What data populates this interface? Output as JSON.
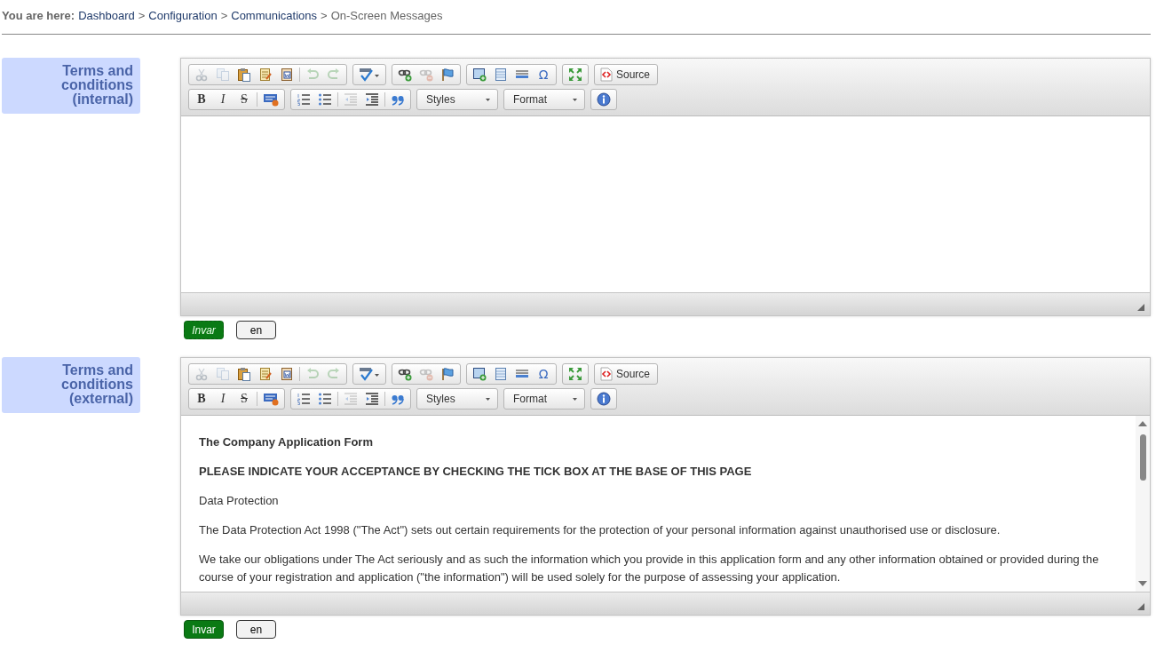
{
  "breadcrumb": {
    "prefix": "You are here:",
    "links": [
      "Dashboard",
      "Configuration",
      "Communications"
    ],
    "separator": ">",
    "current": "On-Screen Messages"
  },
  "fields": [
    {
      "label": "Terms and conditions (internal)",
      "editor": {
        "toolbar_rows": [
          [
            {
              "items": [
                {
                  "kind": "cut",
                  "disabled": true
                },
                {
                  "kind": "copy",
                  "disabled": true
                },
                {
                  "kind": "paste",
                  "disabled": false
                },
                {
                  "kind": "paste-text",
                  "disabled": false
                },
                {
                  "kind": "paste-word",
                  "disabled": false
                },
                {
                  "kind": "separator"
                },
                {
                  "kind": "undo",
                  "disabled": true
                },
                {
                  "kind": "redo",
                  "disabled": true
                }
              ]
            },
            {
              "items": [
                {
                  "kind": "spellcheck",
                  "disabled": false
                }
              ]
            },
            {
              "items": [
                {
                  "kind": "link",
                  "disabled": false
                },
                {
                  "kind": "unlink",
                  "disabled": true
                },
                {
                  "kind": "anchor",
                  "disabled": false
                }
              ]
            },
            {
              "items": [
                {
                  "kind": "image",
                  "disabled": false
                },
                {
                  "kind": "table",
                  "disabled": false
                },
                {
                  "kind": "rule",
                  "disabled": false
                },
                {
                  "kind": "glyph",
                  "glyph": "Ω",
                  "disabled": false
                }
              ]
            },
            {
              "items": [
                {
                  "kind": "maximize",
                  "disabled": false
                }
              ]
            },
            {
              "items": [
                {
                  "kind": "source",
                  "label": "Source",
                  "disabled": false
                }
              ]
            }
          ],
          [
            {
              "items": [
                {
                  "kind": "bold",
                  "glyph": "B",
                  "disabled": false
                },
                {
                  "kind": "italic",
                  "glyph": "I",
                  "disabled": false
                },
                {
                  "kind": "strike",
                  "glyph": "S",
                  "disabled": false
                },
                {
                  "kind": "separator"
                },
                {
                  "kind": "html",
                  "disabled": false
                }
              ]
            },
            {
              "items": [
                {
                  "kind": "numbered-list",
                  "disabled": false
                },
                {
                  "kind": "bulleted-list",
                  "disabled": false
                },
                {
                  "kind": "separator"
                },
                {
                  "kind": "outdent",
                  "disabled": true
                },
                {
                  "kind": "indent",
                  "disabled": false
                },
                {
                  "kind": "separator"
                },
                {
                  "kind": "blockquote",
                  "disabled": false
                }
              ]
            },
            {
              "items": [
                {
                  "kind": "combo",
                  "label": "Styles"
                }
              ]
            },
            {
              "items": [
                {
                  "kind": "combo",
                  "label": "Format"
                }
              ]
            },
            {
              "items": [
                {
                  "kind": "about",
                  "disabled": false
                }
              ]
            }
          ]
        ],
        "scrollable": false
      },
      "buttons": [
        {
          "label": "Invar",
          "kind": "primary",
          "focused": true
        },
        {
          "label": "en",
          "kind": "secondary",
          "focused": false
        }
      ]
    },
    {
      "label": "Terms and conditions (external)",
      "editor": {
        "toolbar_rows": [
          [
            {
              "items": [
                {
                  "kind": "cut",
                  "disabled": true
                },
                {
                  "kind": "copy",
                  "disabled": true
                },
                {
                  "kind": "paste",
                  "disabled": false
                },
                {
                  "kind": "paste-text",
                  "disabled": false
                },
                {
                  "kind": "paste-word",
                  "disabled": false
                },
                {
                  "kind": "separator"
                },
                {
                  "kind": "undo",
                  "disabled": true
                },
                {
                  "kind": "redo",
                  "disabled": true
                }
              ]
            },
            {
              "items": [
                {
                  "kind": "spellcheck",
                  "disabled": false
                }
              ]
            },
            {
              "items": [
                {
                  "kind": "link",
                  "disabled": false
                },
                {
                  "kind": "unlink",
                  "disabled": true
                },
                {
                  "kind": "anchor",
                  "disabled": false
                }
              ]
            },
            {
              "items": [
                {
                  "kind": "image",
                  "disabled": false
                },
                {
                  "kind": "table",
                  "disabled": false
                },
                {
                  "kind": "rule",
                  "disabled": false
                },
                {
                  "kind": "glyph",
                  "glyph": "Ω",
                  "disabled": false
                }
              ]
            },
            {
              "items": [
                {
                  "kind": "maximize",
                  "disabled": false
                }
              ]
            },
            {
              "items": [
                {
                  "kind": "source",
                  "label": "Source",
                  "disabled": false
                }
              ]
            }
          ],
          [
            {
              "items": [
                {
                  "kind": "bold",
                  "glyph": "B",
                  "disabled": false
                },
                {
                  "kind": "italic",
                  "glyph": "I",
                  "disabled": false
                },
                {
                  "kind": "strike",
                  "glyph": "S",
                  "disabled": false
                },
                {
                  "kind": "separator"
                },
                {
                  "kind": "html",
                  "disabled": false
                }
              ]
            },
            {
              "items": [
                {
                  "kind": "numbered-list",
                  "disabled": false
                },
                {
                  "kind": "bulleted-list",
                  "disabled": false
                },
                {
                  "kind": "separator"
                },
                {
                  "kind": "outdent",
                  "disabled": true
                },
                {
                  "kind": "indent",
                  "disabled": false
                },
                {
                  "kind": "separator"
                },
                {
                  "kind": "blockquote",
                  "disabled": false
                }
              ]
            },
            {
              "items": [
                {
                  "kind": "combo",
                  "label": "Styles"
                }
              ]
            },
            {
              "items": [
                {
                  "kind": "combo",
                  "label": "Format"
                }
              ]
            },
            {
              "items": [
                {
                  "kind": "about",
                  "disabled": false
                }
              ]
            }
          ]
        ],
        "scrollable": true,
        "paragraphs": [
          {
            "text": "The Company Application Form",
            "bold": true
          },
          {
            "text": "PLEASE INDICATE YOUR ACCEPTANCE BY CHECKING THE TICK BOX AT THE BASE OF THIS PAGE",
            "bold": true
          },
          {
            "text": "Data Protection",
            "bold": false
          },
          {
            "text": "The Data Protection Act 1998 (\"The Act\") sets out certain requirements for the protection of your personal information against unauthorised use or disclosure.",
            "bold": false
          },
          {
            "text": "We take our obligations under The Act seriously and as such the information which you provide in this application form and any other information obtained or provided during the course of your registration and application (\"the information\") will be used solely for the purpose of assessing your application.",
            "bold": false
          }
        ]
      },
      "buttons": [
        {
          "label": "Invar",
          "kind": "primary",
          "focused": false
        },
        {
          "label": "en",
          "kind": "secondary",
          "focused": false
        }
      ]
    }
  ]
}
